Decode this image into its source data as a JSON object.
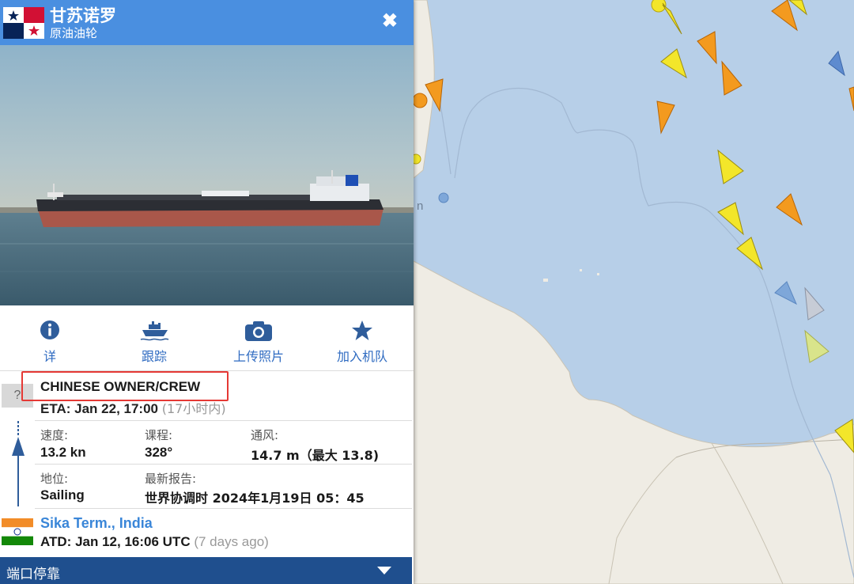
{
  "header": {
    "ship_name": "甘苏诺罗",
    "ship_type": "原油油轮",
    "close_label": "✖",
    "flag": "panama-flag"
  },
  "actions": [
    {
      "label": "详",
      "icon": "info-icon"
    },
    {
      "label": "跟踪",
      "icon": "ship-track-icon"
    },
    {
      "label": "上传照片",
      "icon": "camera-icon"
    },
    {
      "label": "加入机队",
      "icon": "star-icon"
    }
  ],
  "voyage": {
    "unknown_port_marker": "?",
    "destination": "CHINESE OWNER/CREW",
    "eta_label": "ETA:",
    "eta_value": "Jan 22, 17:00",
    "eta_relative": "(17小时内)"
  },
  "stats": {
    "speed_label": "速度:",
    "speed_value": "13.2 kn",
    "course_label": "课程:",
    "course_value": "328°",
    "draught_label": "通风:",
    "draught_value": "14.7 m（最大 13.8)",
    "status_label": "地位:",
    "status_value": "Sailing",
    "report_label": "最新报告:",
    "report_value": "世界协调时 2024年1月19日 05：45"
  },
  "departure": {
    "flag": "india-flag",
    "port_name": "Sika Term., India",
    "atd_label": "ATD:",
    "atd_value": "Jan 12, 16:06 UTC",
    "atd_relative": "(7 days ago)"
  },
  "port_calls": {
    "label": "端口停靠"
  },
  "map": {
    "sea_color": "#b7cfe8",
    "land_color": "#efece4",
    "map_label_fragment": "n"
  },
  "colors": {
    "header_blue": "#4a8fe0",
    "action_blue": "#2f6bc1",
    "port_bar": "#1f4f8e",
    "highlight_red": "#e53935",
    "link_blue": "#3a86d8"
  }
}
